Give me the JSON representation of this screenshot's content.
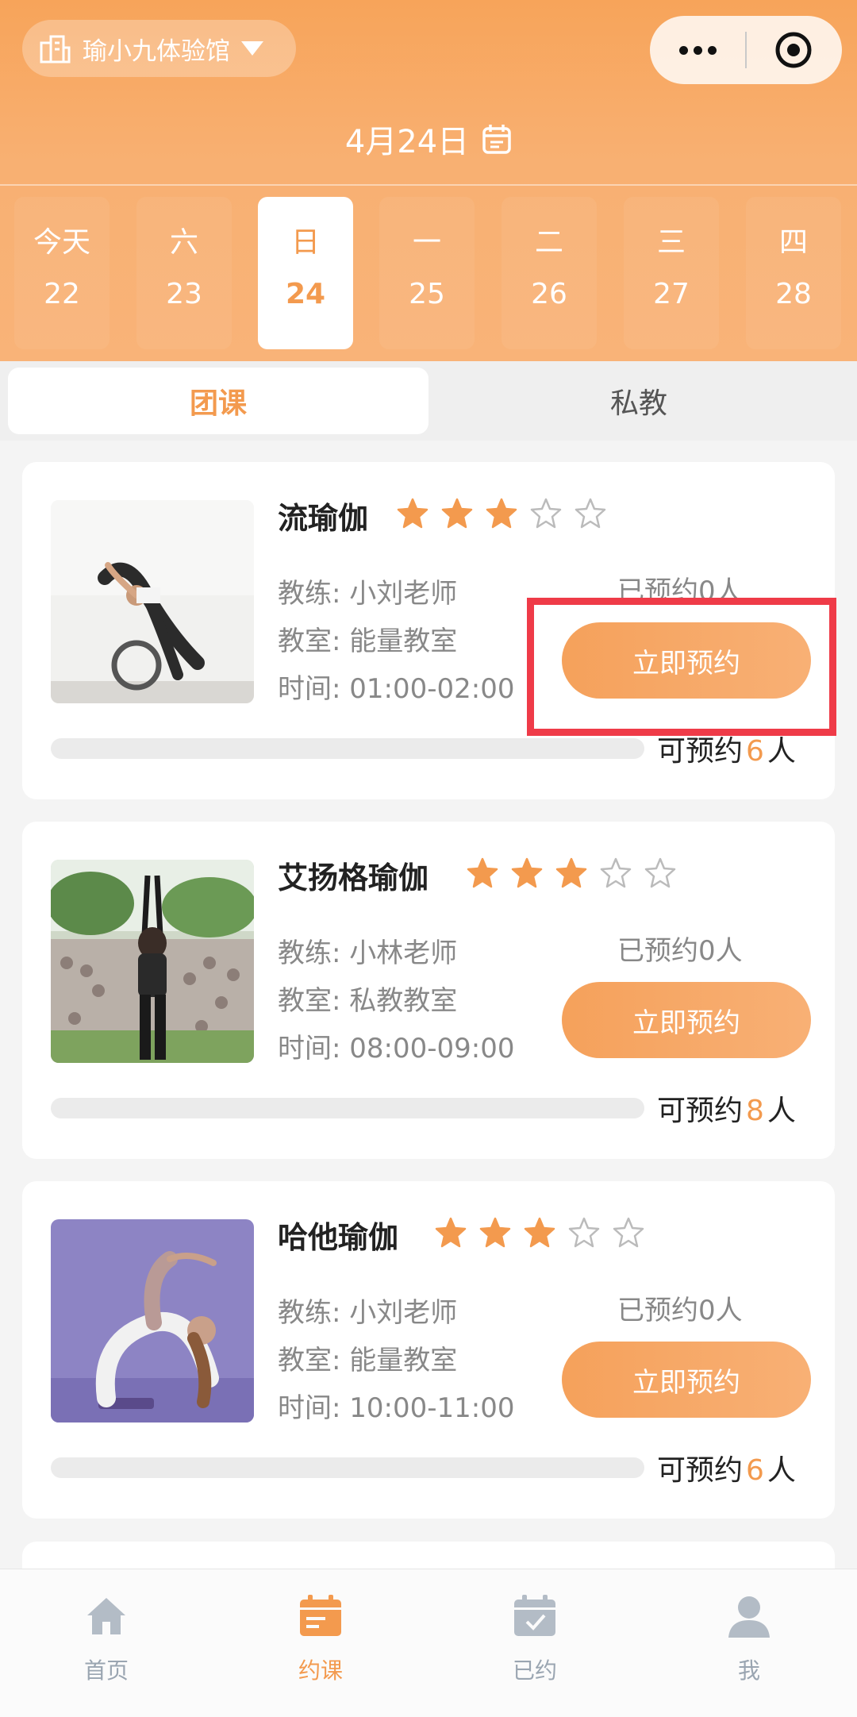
{
  "header": {
    "venue_name": "瑜小九体验馆",
    "date_label": "4月24日",
    "capsule": {
      "more_icon": "more-dots-icon",
      "close_icon": "target-circle-icon"
    }
  },
  "week_days": [
    {
      "weekday": "今天",
      "date": "22",
      "selected": false
    },
    {
      "weekday": "六",
      "date": "23",
      "selected": false
    },
    {
      "weekday": "日",
      "date": "24",
      "selected": true
    },
    {
      "weekday": "一",
      "date": "25",
      "selected": false
    },
    {
      "weekday": "二",
      "date": "26",
      "selected": false
    },
    {
      "weekday": "三",
      "date": "27",
      "selected": false
    },
    {
      "weekday": "四",
      "date": "28",
      "selected": false
    }
  ],
  "tabs": [
    {
      "label": "团课",
      "active": true
    },
    {
      "label": "私教",
      "active": false
    }
  ],
  "labels": {
    "coach": "教练:",
    "room": "教室:",
    "time": "时间:",
    "book_button": "立即预约",
    "available_prefix": "可预约",
    "available_suffix": "人"
  },
  "courses": [
    {
      "title": "流瑜伽",
      "rating": 3,
      "max_rating": 5,
      "coach": "小刘老师",
      "room": "能量教室",
      "time": "01:00-02:00",
      "booked": "已预约0人",
      "available": "6"
    },
    {
      "title": "艾扬格瑜伽",
      "rating": 3,
      "max_rating": 5,
      "coach": "小林老师",
      "room": "私教教室",
      "time": "08:00-09:00",
      "booked": "已预约0人",
      "available": "8"
    },
    {
      "title": "哈他瑜伽",
      "rating": 3,
      "max_rating": 5,
      "coach": "小刘老师",
      "room": "能量教室",
      "time": "10:00-11:00",
      "booked": "已预约0人",
      "available": "6"
    }
  ],
  "bottom_nav": [
    {
      "label": "首页",
      "icon": "home-icon",
      "active": false
    },
    {
      "label": "约课",
      "icon": "calendar-book-icon",
      "active": true
    },
    {
      "label": "已约",
      "icon": "calendar-check-icon",
      "active": false
    },
    {
      "label": "我",
      "icon": "user-icon",
      "active": false
    }
  ],
  "colors": {
    "accent": "#f39a4e",
    "header": "#f7a45a",
    "highlight": "#ef3b48"
  }
}
